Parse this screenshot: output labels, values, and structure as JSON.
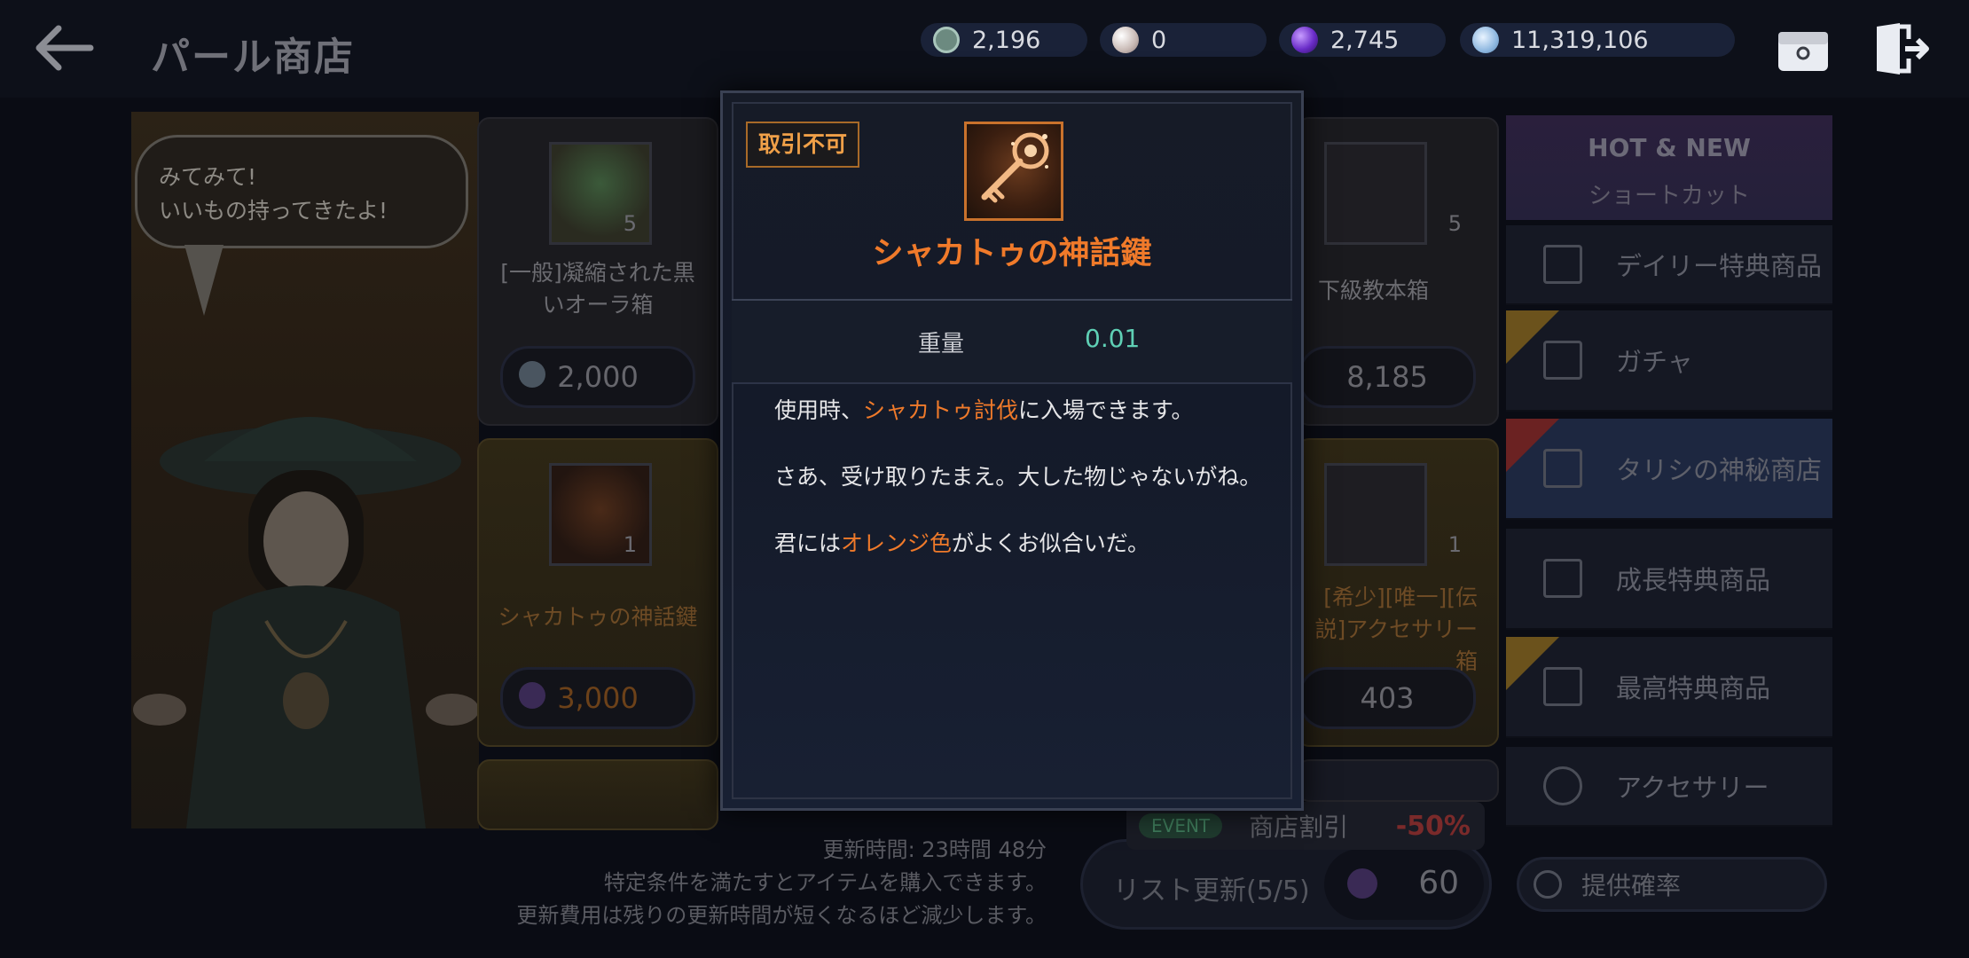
{
  "header": {
    "title": "パール商店",
    "currencies": [
      {
        "icon": "gem-hexagon-icon",
        "value": "2,196",
        "color": "#8fb5a8"
      },
      {
        "icon": "pearl-icon",
        "value": "0",
        "color": "#e8dcd6"
      },
      {
        "icon": "purple-orb-icon",
        "value": "2,745",
        "color": "#7b3fd6"
      },
      {
        "icon": "silver-coin-icon",
        "value": "11,319,106",
        "color": "#9fc4ea"
      }
    ]
  },
  "npc": {
    "speech": [
      "みてみて!",
      "いいもの持ってきたよ!"
    ]
  },
  "shop": {
    "cards": [
      {
        "name": "[一般]凝縮された黒いオーラ箱",
        "qty": "5",
        "price": "2,000"
      },
      {
        "name": "下級教本箱",
        "qty": "5",
        "price": "8,185"
      },
      {
        "name": "シャカトゥの神話鍵",
        "qty": "1",
        "price": "3,000"
      },
      {
        "name": "[希少][唯一][伝説]アクセサリー箱",
        "qty": "1",
        "price": "403"
      }
    ]
  },
  "sidebar": {
    "hot_title": "HOT & NEW",
    "hot_sub": "ショートカット",
    "items": [
      {
        "label": "デイリー特典商品"
      },
      {
        "label": "ガチャ"
      },
      {
        "label": "タリシの神秘商店"
      },
      {
        "label": "成長特典商品"
      },
      {
        "label": "最高特典商品"
      },
      {
        "label": "アクセサリー"
      }
    ]
  },
  "bottom": {
    "refresh_time": "更新時間: 23時間 48分",
    "note1": "特定条件を満たすとアイテムを購入できます。",
    "note2": "更新費用は残りの更新時間が短くなるほど減少します。",
    "refresh_label": "リスト更新(5/5)",
    "refresh_cost": "60",
    "event_pill": "EVENT",
    "event_name": "商店割引",
    "event_discount": "-50%",
    "probability": "提供確率"
  },
  "popup": {
    "badge": "取引不可",
    "item_name": "シャカトゥの神話鍵",
    "weight_label": "重量",
    "weight_value": "0.01",
    "desc1_pre": "使用時、",
    "desc1_hl": "シャカトゥ討伐",
    "desc1_post": "に入場できます。",
    "desc2": "さあ、受け取りたまえ。大した物じゃないがね。",
    "desc3_pre": "君には",
    "desc3_hl": "オレンジ色",
    "desc3_post": "がよくお似合いだ。",
    "accent_color": "#f07a2a"
  }
}
